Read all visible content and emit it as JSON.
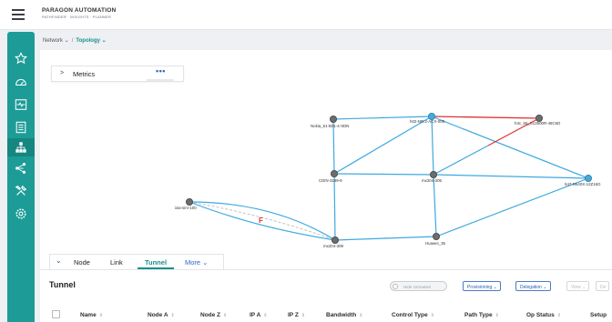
{
  "header": {
    "brand_title": "PARAGON AUTOMATION",
    "brand_subtitle": "PATHFINDER · INSIGHTS · PLANNER"
  },
  "sidebar": {
    "items": [
      {
        "icon": "star-icon"
      },
      {
        "icon": "dashboard-gauge-icon"
      },
      {
        "icon": "monitor-pulse-icon"
      },
      {
        "icon": "document-list-icon"
      },
      {
        "icon": "network-topology-icon",
        "active": true
      },
      {
        "icon": "share-nodes-icon"
      },
      {
        "icon": "tools-icon"
      },
      {
        "icon": "settings-gear-icon"
      }
    ],
    "accent_color": "#1d9c97"
  },
  "breadcrumb": {
    "root": "Network",
    "separator": "/",
    "current": "Topology"
  },
  "metrics": {
    "label": "Metrics",
    "more": "•••"
  },
  "topology": {
    "nodes": [
      {
        "id": "n1",
        "label": "Nokia_61-B01-4-SDN"
      },
      {
        "id": "n2",
        "label": "h02-NR.2-ACX-005"
      },
      {
        "id": "n3",
        "label": "h3c_55_S12500R-48C6D"
      },
      {
        "id": "n4",
        "label": "CIEN-3189-9"
      },
      {
        "id": "n5",
        "label": "mx204-305"
      },
      {
        "id": "n6",
        "label": "547-N540X-12Z16G"
      },
      {
        "id": "n7",
        "label": "ixia-sim-100"
      },
      {
        "id": "n8",
        "label": "mx204-309"
      },
      {
        "id": "n9",
        "label": "Huawei_35"
      }
    ],
    "warning_marker": "F",
    "link_color": "#3fa9e0",
    "down_link_color": "#e03131"
  },
  "tabs": {
    "items": [
      "Node",
      "Link",
      "Tunnel"
    ],
    "more": "More",
    "active": "Tunnel"
  },
  "tunnel": {
    "title": "Tunnel",
    "hide_unrouted": "Hide Unrouted",
    "buttons": {
      "provisioning": "Provisioning",
      "delegation": "Delegation",
      "view": "View",
      "partial": "De"
    },
    "columns": [
      "Name",
      "Node A",
      "Node Z",
      "IP A",
      "IP Z",
      "Bandwidth",
      "Control Type",
      "Path Type",
      "Op Status",
      "Setup"
    ],
    "sort_glyph": "⇕"
  }
}
